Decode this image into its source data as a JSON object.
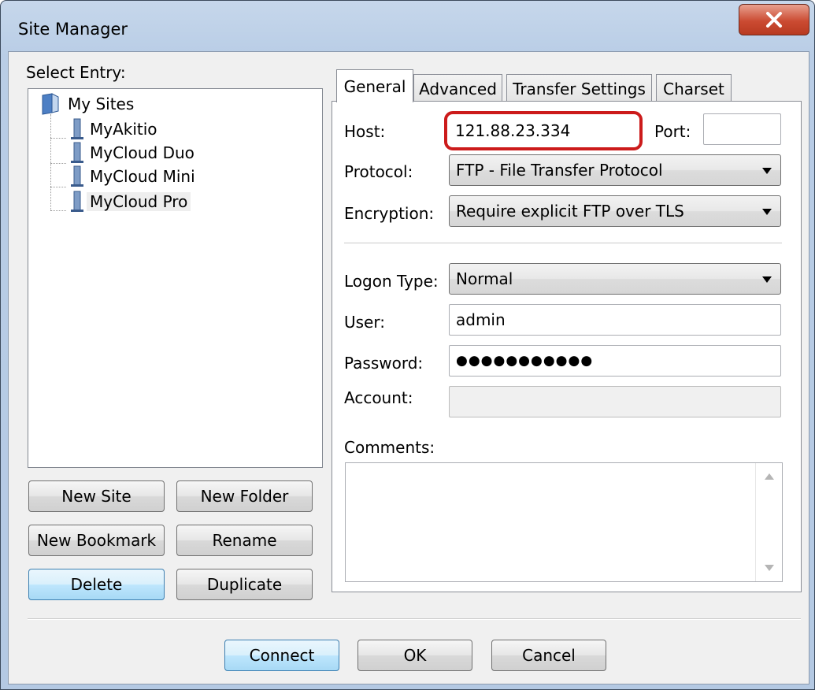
{
  "window": {
    "title": "Site Manager"
  },
  "left_panel": {
    "select_entry_label": "Select Entry:",
    "root": "My Sites",
    "sites": [
      {
        "label": "MyAkitio"
      },
      {
        "label": "MyCloud Duo"
      },
      {
        "label": "MyCloud Mini"
      },
      {
        "label": "MyCloud Pro",
        "selected": true
      }
    ],
    "buttons": {
      "new_site": "New Site",
      "new_folder": "New Folder",
      "new_bookmark": "New Bookmark",
      "rename": "Rename",
      "delete": "Delete",
      "duplicate": "Duplicate"
    }
  },
  "tabs": [
    {
      "label": "General",
      "active": true
    },
    {
      "label": "Advanced"
    },
    {
      "label": "Transfer Settings"
    },
    {
      "label": "Charset"
    }
  ],
  "general": {
    "host_label": "Host:",
    "host_value": "121.88.23.334",
    "port_label": "Port:",
    "port_value": "",
    "protocol_label": "Protocol:",
    "protocol_value": "FTP - File Transfer Protocol",
    "encryption_label": "Encryption:",
    "encryption_value": "Require explicit FTP over TLS",
    "logon_type_label": "Logon Type:",
    "logon_type_value": "Normal",
    "user_label": "User:",
    "user_value": "admin",
    "password_label": "Password:",
    "password_value": "●●●●●●●●●●●",
    "account_label": "Account:",
    "account_value": "",
    "comments_label": "Comments:",
    "comments_value": ""
  },
  "footer": {
    "connect": "Connect",
    "ok": "OK",
    "cancel": "Cancel"
  },
  "colors": {
    "highlight": "#cc1b1b",
    "close_button": "#cb4b32",
    "focus_button": "#bee6fd"
  }
}
